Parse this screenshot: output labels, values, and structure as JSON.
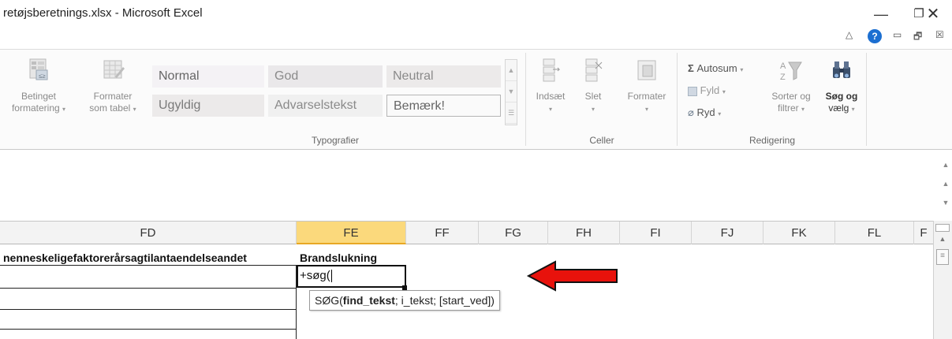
{
  "window": {
    "title": "retøjsberetnings.xlsx - Microsoft Excel",
    "minimize_glyph": "—",
    "restore_glyph": "❐",
    "close_glyph": "✕"
  },
  "ribbon_top": {
    "collapse_glyph": "△",
    "help_glyph": "?",
    "mini_min_glyph": "▭",
    "mini_restore_glyph": "🗗",
    "mini_close_glyph": "☒"
  },
  "ribbon": {
    "conditional_formatting": {
      "line1": "Betinget",
      "line2": "formatering"
    },
    "format_as_table": {
      "line1": "Formater",
      "line2": "som tabel"
    },
    "styles": {
      "normal": "Normal",
      "good": "God",
      "neutral": "Neutral",
      "bad": "Ugyldig",
      "warning": "Advarselstekst",
      "note": "Bemærk!"
    },
    "styles_group_label": "Typografier",
    "insert": "Indsæt",
    "delete": "Slet",
    "format": "Formater",
    "cells_group_label": "Celler",
    "autosum": "Autosum",
    "fill": "Fyld",
    "clear": "Ryd",
    "sort_filter": {
      "line1": "Sorter og",
      "line2": "filtrer"
    },
    "find_select": {
      "line1": "Søg og",
      "line2": "vælg"
    },
    "editing_group_label": "Redigering",
    "sigma_glyph": "Σ"
  },
  "columns": [
    {
      "id": "FD",
      "label": "FD",
      "active": false
    },
    {
      "id": "FE",
      "label": "FE",
      "active": true
    },
    {
      "id": "FF",
      "label": "FF",
      "active": false
    },
    {
      "id": "FG",
      "label": "FG",
      "active": false
    },
    {
      "id": "FH",
      "label": "FH",
      "active": false
    },
    {
      "id": "FI",
      "label": "FI",
      "active": false
    },
    {
      "id": "FJ",
      "label": "FJ",
      "active": false
    },
    {
      "id": "FK",
      "label": "FK",
      "active": false
    },
    {
      "id": "FL",
      "label": "FL",
      "active": false
    },
    {
      "id": "FM",
      "label": "F",
      "active": false
    }
  ],
  "grid": {
    "fd_header": "nenneskeligefaktorerårsagtilantaendelseandet",
    "fe_header": "Brandslukning",
    "edit_value": "+søg(",
    "tooltip": {
      "func": "SØG(",
      "arg_bold": "find_tekst",
      "rest": "; i_tekst; [start_ved])"
    }
  },
  "annotation": {
    "arrow_color": "#e8120c"
  }
}
